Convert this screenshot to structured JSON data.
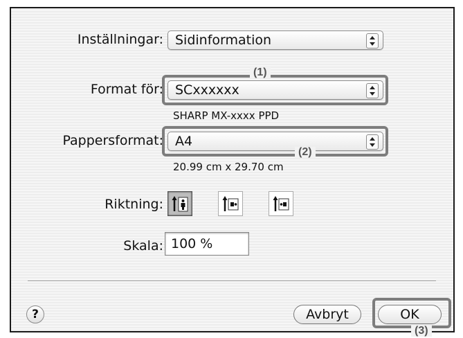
{
  "dialog": {
    "settings": {
      "label": "Inställningar:",
      "value": "Sidinformation"
    },
    "format_for": {
      "label": "Format för:",
      "value": "SCxxxxxx",
      "description": "SHARP MX-xxxx PPD"
    },
    "paper_size": {
      "label": "Pappersformat:",
      "value": "A4",
      "dimensions": "20.99 cm x 29.70 cm"
    },
    "orientation": {
      "label": "Riktning:",
      "options": [
        {
          "name": "portrait",
          "selected": true
        },
        {
          "name": "landscape-left",
          "selected": false
        },
        {
          "name": "landscape-right",
          "selected": false
        }
      ]
    },
    "scale": {
      "label": "Skala:",
      "value": "100 %"
    },
    "buttons": {
      "help": "?",
      "cancel": "Avbryt",
      "ok": "OK"
    }
  },
  "callouts": [
    "(1)",
    "(2)",
    "(3)"
  ]
}
